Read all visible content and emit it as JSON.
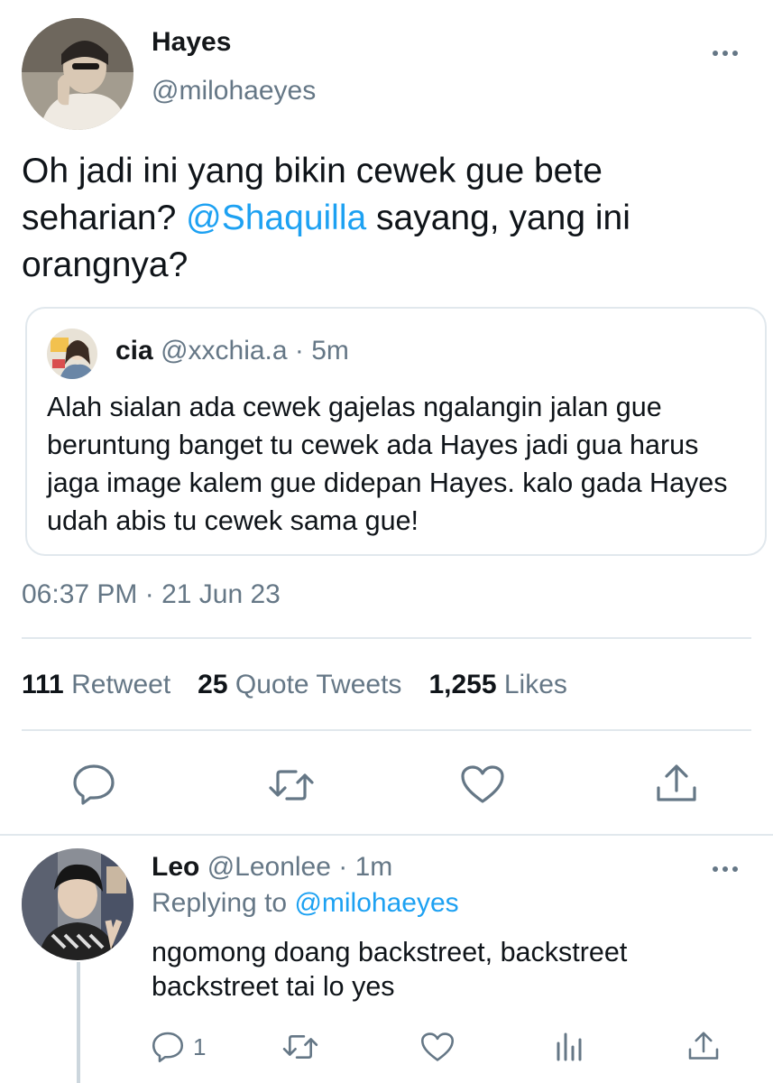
{
  "main_tweet": {
    "display_name": "Hayes",
    "handle": "@milohaeyes",
    "text_part1": "Oh jadi ini yang bikin cewek gue bete seharian? ",
    "mention": "@Shaquilla",
    "text_part2": " sayang, yang ini orangnya?",
    "timestamp": "06:37 PM · 21 Jun 23"
  },
  "quoted_tweet": {
    "display_name": "cia",
    "handle": "@xxchia.a",
    "time": "· 5m",
    "text": "Alah sialan ada cewek gajelas ngalangin jalan gue beruntung banget tu cewek ada Hayes jadi gua harus jaga image kalem gue didepan Hayes. kalo gada Hayes udah abis tu cewek sama gue!"
  },
  "stats": {
    "retweet_count": "111",
    "retweet_label": "Retweet",
    "quote_count": "25",
    "quote_label": "Quote Tweets",
    "likes_count": "1,255",
    "likes_label": "Likes"
  },
  "actions": [
    "reply-icon",
    "retweet-icon",
    "like-icon",
    "share-icon"
  ],
  "reply": {
    "display_name": "Leo",
    "handle": "@Leonlee",
    "time": "· 1m",
    "replying_prefix": "Replying to",
    "replying_to": "@milohaeyes",
    "text": "ngomong doang backstreet, backstreet backstreet tai lo yes",
    "reply_count": "1",
    "action_icons": [
      "reply-icon",
      "retweet-icon",
      "like-icon",
      "analytics-icon",
      "share-icon"
    ]
  },
  "colors": {
    "link": "#1da1f2",
    "muted": "#657786",
    "divider": "#e1e8ed",
    "text": "#0f1419"
  }
}
